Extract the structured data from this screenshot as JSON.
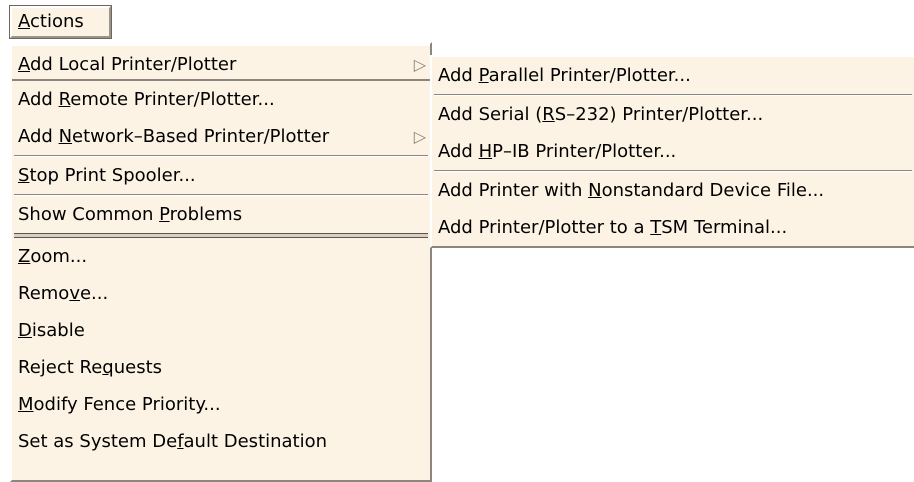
{
  "menubar": {
    "title_mnemonic": "A",
    "title_rest": "ctions"
  },
  "main_menu": {
    "items": [
      {
        "pre": "",
        "mnem": "A",
        "post": "dd Local Printer/Plotter",
        "arrow": "▷"
      },
      {
        "pre": "Add ",
        "mnem": "R",
        "post": "emote Printer/Plotter..."
      },
      {
        "pre": "Add ",
        "mnem": "N",
        "post": "etwork–Based Printer/Plotter",
        "arrow": "▷"
      },
      {
        "pre": "",
        "mnem": "S",
        "post": "top Print Spooler..."
      },
      {
        "pre": "Show Common ",
        "mnem": "P",
        "post": "roblems"
      },
      {
        "pre": "",
        "mnem": "Z",
        "post": "oom..."
      },
      {
        "pre": "Remo",
        "mnem": "v",
        "post": "e..."
      },
      {
        "pre": "",
        "mnem": "D",
        "post": "isable"
      },
      {
        "pre": "Reject Re",
        "mnem": "q",
        "post": "uests"
      },
      {
        "pre": "",
        "mnem": "M",
        "post": "odify Fence Priority..."
      },
      {
        "pre": "Set as System De",
        "mnem": "f",
        "post": "ault Destination"
      }
    ]
  },
  "sub_menu": {
    "items": [
      {
        "pre": "Add ",
        "mnem": "P",
        "post": "arallel Printer/Plotter..."
      },
      {
        "pre": "Add Serial (",
        "mnem": "R",
        "post": "S–232) Printer/Plotter..."
      },
      {
        "pre": "Add ",
        "mnem": "H",
        "post": "P–IB Printer/Plotter..."
      },
      {
        "pre": "Add Printer with ",
        "mnem": "N",
        "post": "onstandard Device File..."
      },
      {
        "pre": "Add Printer/Plotter to a ",
        "mnem": "T",
        "post": "SM Terminal..."
      }
    ]
  }
}
